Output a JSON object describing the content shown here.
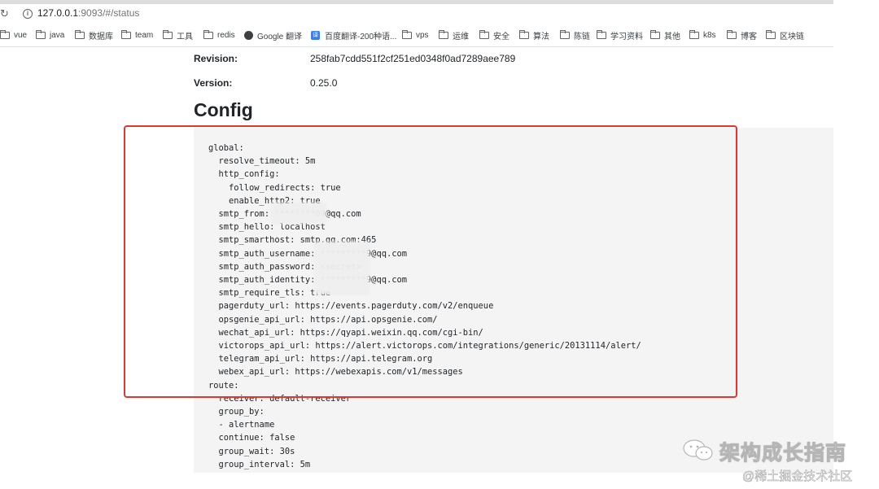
{
  "browser": {
    "url_host": "127.0.0.1",
    "url_rest": ":9093/#/status",
    "bookmarks": [
      {
        "label": "vue",
        "icon": "folder-icon"
      },
      {
        "label": "java",
        "icon": "folder-icon"
      },
      {
        "label": "数据库",
        "icon": "folder-icon"
      },
      {
        "label": "team",
        "icon": "folder-icon"
      },
      {
        "label": "工具",
        "icon": "folder-icon"
      },
      {
        "label": "redis",
        "icon": "folder-icon"
      },
      {
        "label": "Google 翻译",
        "icon": "globe-icon"
      },
      {
        "label": "百度翻译-200种语...",
        "icon": "baidu-icon"
      },
      {
        "label": "vps",
        "icon": "folder-icon"
      },
      {
        "label": "运维",
        "icon": "folder-icon"
      },
      {
        "label": "安全",
        "icon": "folder-icon"
      },
      {
        "label": "算法",
        "icon": "folder-icon"
      },
      {
        "label": "陈链",
        "icon": "folder-icon"
      },
      {
        "label": "学习资料",
        "icon": "folder-icon"
      },
      {
        "label": "其他",
        "icon": "folder-icon"
      },
      {
        "label": "k8s",
        "icon": "folder-icon"
      },
      {
        "label": "博客",
        "icon": "folder-icon"
      },
      {
        "label": "区块链",
        "icon": "folder-icon"
      }
    ]
  },
  "status": {
    "revision_label": "Revision:",
    "revision_value": "258fab7cdd551f2cf251ed0348f0ad7289aee789",
    "version_label": "Version:",
    "version_value": "0.25.0"
  },
  "config": {
    "title": "Config",
    "lines": [
      "global:",
      "  resolve_timeout: 5m",
      "  http_config:",
      "    follow_redirects: true",
      "    enable_http2: true",
      "  smtp_from: ********09@qq.com",
      "  smtp_hello: localhost",
      "  smtp_smarthost: smtp.qq.com:465",
      "  smtp_auth_username: *********9@qq.com",
      "  smtp_auth_password: <secret>",
      "  smtp_auth_identity: *********9@qq.com",
      "  smtp_require_tls: true",
      "  pagerduty_url: https://events.pagerduty.com/v2/enqueue",
      "  opsgenie_api_url: https://api.opsgenie.com/",
      "  wechat_api_url: https://qyapi.weixin.qq.com/cgi-bin/",
      "  victorops_api_url: https://alert.victorops.com/integrations/generic/20131114/alert/",
      "  telegram_api_url: https://api.telegram.org",
      "  webex_api_url: https://webexapis.com/v1/messages",
      "route:",
      "  receiver: default-receiver",
      "  group_by:",
      "  - alertname",
      "  continue: false",
      "  group_wait: 30s",
      "  group_interval: 5m"
    ]
  },
  "watermark": {
    "title": "架构成长指南",
    "subtitle": "@稀土掘金技术社区"
  },
  "colors": {
    "highlight": "#e0372e",
    "code_background": "#f4f4f4"
  }
}
